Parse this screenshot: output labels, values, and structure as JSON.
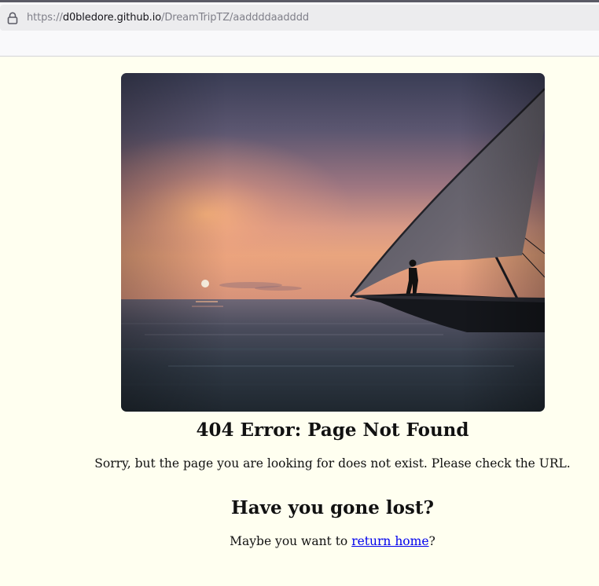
{
  "browser": {
    "url_scheme": "https://",
    "url_host": "d0bledore.github.io",
    "url_path": "/DreamTripTZ/aaddddaadddd"
  },
  "page": {
    "image_alt": "Dhow sailboat silhouetted at sunset over the ocean",
    "title": "404 Error: Page Not Found",
    "message": "Sorry, but the page you are looking for does not exist. Please check the URL.",
    "subtitle": "Have you gone lost?",
    "suggest_prefix": "Maybe you want to ",
    "return_link": "return home",
    "suggest_suffix": "?"
  },
  "colors": {
    "page_background": "#fffff0",
    "link": "#0000ee"
  }
}
